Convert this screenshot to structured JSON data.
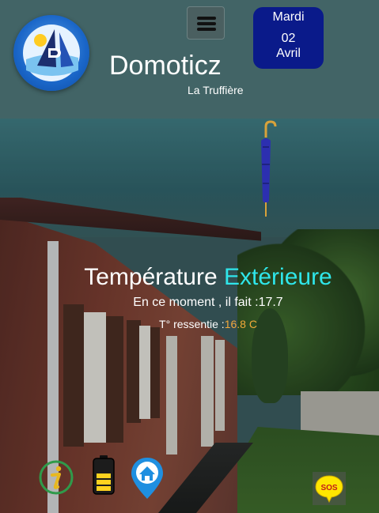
{
  "header": {
    "title": "Domoticz",
    "subtitle": "La Truffière",
    "date": {
      "day": "Mardi",
      "number": "02",
      "month": "Avril"
    }
  },
  "icons": {
    "logo": "domoticz-logo",
    "menu": "hamburger-icon",
    "umbrella": "umbrella-icon",
    "info": "info-icon",
    "battery": "battery-icon",
    "home": "home-location-icon",
    "sos": "sos-icon"
  },
  "temperature": {
    "title": "Température",
    "title_accent": "Extérieure",
    "now_label": "En ce moment , il fait :",
    "now_value": "17.7",
    "felt_label": "T° ressentie :",
    "felt_value": "16.8 C"
  },
  "colors": {
    "accent": "#2fe6ea",
    "felt_value": "#f2a93a",
    "date_box": "#0a1a8a",
    "sos": "#ffe600"
  }
}
